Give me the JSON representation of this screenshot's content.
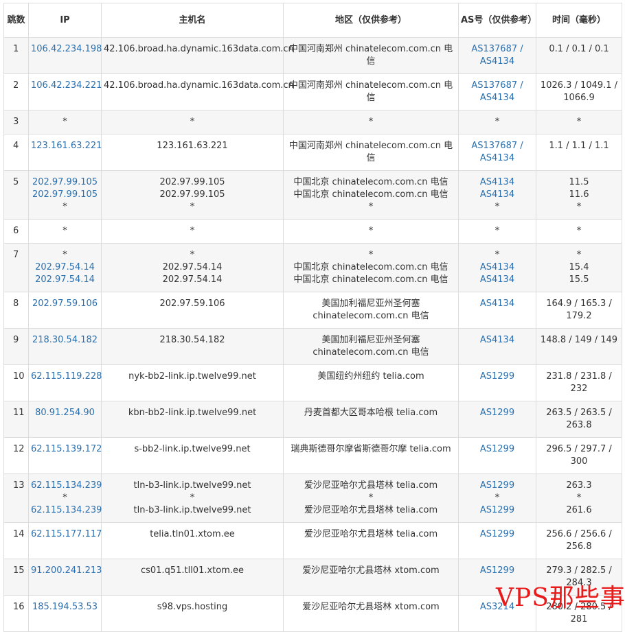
{
  "headers": [
    "跳数",
    "IP",
    "主机名",
    "地区（仅供参考）",
    "AS号（仅供参考）",
    "时间（毫秒）"
  ],
  "rows": [
    {
      "hop": "1",
      "ip": [
        "106.42.234.198"
      ],
      "host": [
        "42.106.broad.ha.dynamic.163data.com.cn"
      ],
      "region": [
        "中国河南郑州 chinatelecom.com.cn 电信"
      ],
      "as": [
        "AS137687 / AS4134"
      ],
      "time": [
        "0.1 / 0.1 / 0.1"
      ]
    },
    {
      "hop": "2",
      "ip": [
        "106.42.234.221"
      ],
      "host": [
        "42.106.broad.ha.dynamic.163data.com.cn"
      ],
      "region": [
        "中国河南郑州 chinatelecom.com.cn 电信"
      ],
      "as": [
        "AS137687 / AS4134"
      ],
      "time": [
        "1026.3 / 1049.1 / 1066.9"
      ]
    },
    {
      "hop": "3",
      "ip": [
        "*"
      ],
      "host": [
        "*"
      ],
      "region": [
        "*"
      ],
      "as": [
        "*"
      ],
      "time": [
        "*"
      ]
    },
    {
      "hop": "4",
      "ip": [
        "123.161.63.221"
      ],
      "host": [
        "123.161.63.221"
      ],
      "region": [
        "中国河南郑州 chinatelecom.com.cn 电信"
      ],
      "as": [
        "AS137687 / AS4134"
      ],
      "time": [
        "1.1 / 1.1 / 1.1"
      ]
    },
    {
      "hop": "5",
      "ip": [
        "202.97.99.105",
        "202.97.99.105",
        "*"
      ],
      "host": [
        "202.97.99.105",
        "202.97.99.105",
        "*"
      ],
      "region": [
        "中国北京 chinatelecom.com.cn 电信",
        "中国北京 chinatelecom.com.cn 电信",
        "*"
      ],
      "as": [
        "AS4134",
        "AS4134",
        "*"
      ],
      "time": [
        "11.5",
        "11.6",
        "*"
      ]
    },
    {
      "hop": "6",
      "ip": [
        "*"
      ],
      "host": [
        "*"
      ],
      "region": [
        "*"
      ],
      "as": [
        "*"
      ],
      "time": [
        "*"
      ]
    },
    {
      "hop": "7",
      "ip": [
        "*",
        "202.97.54.14",
        "202.97.54.14"
      ],
      "host": [
        "*",
        "202.97.54.14",
        "202.97.54.14"
      ],
      "region": [
        "*",
        "中国北京 chinatelecom.com.cn 电信",
        "中国北京 chinatelecom.com.cn 电信"
      ],
      "as": [
        "*",
        "AS4134",
        "AS4134"
      ],
      "time": [
        "*",
        "15.4",
        "15.5"
      ]
    },
    {
      "hop": "8",
      "ip": [
        "202.97.59.106"
      ],
      "host": [
        "202.97.59.106"
      ],
      "region": [
        "美国加利福尼亚州圣何塞 chinatelecom.com.cn 电信"
      ],
      "as": [
        "AS4134"
      ],
      "time": [
        "164.9 / 165.3 / 179.2"
      ]
    },
    {
      "hop": "9",
      "ip": [
        "218.30.54.182"
      ],
      "host": [
        "218.30.54.182"
      ],
      "region": [
        "美国加利福尼亚州圣何塞 chinatelecom.com.cn 电信"
      ],
      "as": [
        "AS4134"
      ],
      "time": [
        "148.8 / 149 / 149"
      ]
    },
    {
      "hop": "10",
      "ip": [
        "62.115.119.228"
      ],
      "host": [
        "nyk-bb2-link.ip.twelve99.net"
      ],
      "region": [
        "美国纽约州纽约 telia.com"
      ],
      "as": [
        "AS1299"
      ],
      "time": [
        "231.8 / 231.8 / 232"
      ]
    },
    {
      "hop": "11",
      "ip": [
        "80.91.254.90"
      ],
      "host": [
        "kbn-bb2-link.ip.twelve99.net"
      ],
      "region": [
        "丹麦首都大区哥本哈根 telia.com"
      ],
      "as": [
        "AS1299"
      ],
      "time": [
        "263.5 / 263.5 / 263.8"
      ]
    },
    {
      "hop": "12",
      "ip": [
        "62.115.139.172"
      ],
      "host": [
        "s-bb2-link.ip.twelve99.net"
      ],
      "region": [
        "瑞典斯德哥尔摩省斯德哥尔摩 telia.com"
      ],
      "as": [
        "AS1299"
      ],
      "time": [
        "296.5 / 297.7 / 300"
      ]
    },
    {
      "hop": "13",
      "ip": [
        "62.115.134.239",
        "*",
        "62.115.134.239"
      ],
      "host": [
        "tln-b3-link.ip.twelve99.net",
        "*",
        "tln-b3-link.ip.twelve99.net"
      ],
      "region": [
        "爱沙尼亚哈尔尤县塔林 telia.com",
        "*",
        "爱沙尼亚哈尔尤县塔林 telia.com"
      ],
      "as": [
        "AS1299",
        "*",
        "AS1299"
      ],
      "time": [
        "263.3",
        "*",
        "261.6"
      ]
    },
    {
      "hop": "14",
      "ip": [
        "62.115.177.117"
      ],
      "host": [
        "telia.tln01.xtom.ee"
      ],
      "region": [
        "爱沙尼亚哈尔尤县塔林 telia.com"
      ],
      "as": [
        "AS1299"
      ],
      "time": [
        "256.6 / 256.6 / 256.8"
      ]
    },
    {
      "hop": "15",
      "ip": [
        "91.200.241.213"
      ],
      "host": [
        "cs01.q51.tll01.xtom.ee"
      ],
      "region": [
        "爱沙尼亚哈尔尤县塔林 xtom.com"
      ],
      "as": [
        "AS1299"
      ],
      "time": [
        "279.3 / 282.5 / 284.3"
      ]
    },
    {
      "hop": "16",
      "ip": [
        "185.194.53.53"
      ],
      "host": [
        "s98.vps.hosting"
      ],
      "region": [
        "爱沙尼亚哈尔尤县塔林 xtom.com"
      ],
      "as": [
        "AS3214"
      ],
      "time": [
        "280.2 / 280.5 / 281"
      ]
    }
  ],
  "watermark": "VPS那些事"
}
